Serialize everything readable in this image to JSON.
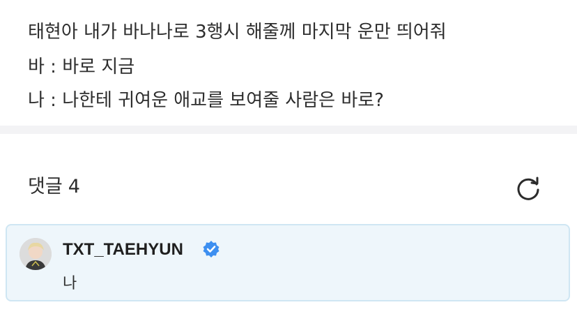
{
  "post": {
    "lines": [
      "태현아 내가 바나나로 3행시 해줄께 마지막 운만 띄어줘",
      "바 : 바로 지금",
      "나 : 나한테 귀여운 애교를 보여줄 사람은 바로?"
    ]
  },
  "comments": {
    "label": "댓글",
    "count": "4",
    "refresh_icon": "refresh-icon"
  },
  "comment": {
    "author": "TXT_TAEHYUN",
    "verified_icon": "verified-badge-icon",
    "text": "나",
    "colors": {
      "card_bg": "#eef6fb",
      "card_border": "#cfe6f3",
      "verified": "#3d8ff0"
    }
  }
}
